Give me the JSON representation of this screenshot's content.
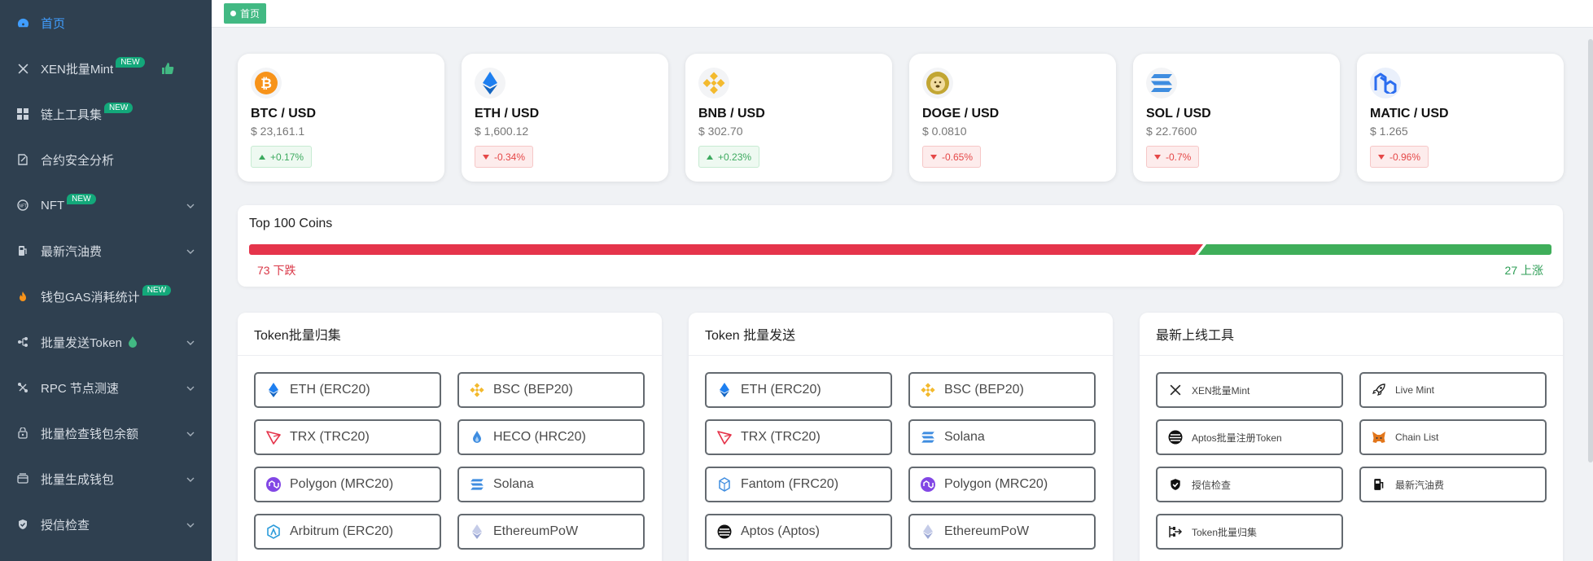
{
  "sidebar": {
    "items": [
      {
        "label": "首页",
        "icon": "dashboard-icon",
        "active": true
      },
      {
        "label": "XEN批量Mint",
        "icon": "x-icon",
        "badge": "NEW"
      },
      {
        "label": "链上工具集",
        "icon": "grid-icon",
        "badge": "NEW"
      },
      {
        "label": "合约安全分析",
        "icon": "contract-icon"
      },
      {
        "label": "NFT",
        "icon": "nft-icon",
        "badge": "NEW",
        "expandable": true
      },
      {
        "label": "最新汽油费",
        "icon": "gas-pump-icon",
        "expandable": true
      },
      {
        "label": "钱包GAS消耗统计",
        "icon": "fire-icon",
        "badge": "NEW"
      },
      {
        "label": "批量发送Token",
        "icon": "send-icon",
        "expandable": true
      },
      {
        "label": "RPC 节点测速",
        "icon": "speed-icon",
        "expandable": true
      },
      {
        "label": "批量检查钱包余额",
        "icon": "balance-icon",
        "expandable": true
      },
      {
        "label": "批量生成钱包",
        "icon": "wallet-icon",
        "expandable": true
      },
      {
        "label": "授信检查",
        "icon": "shield-icon",
        "expandable": true
      }
    ]
  },
  "tagbar": {
    "home_tag": "首页"
  },
  "prices": [
    {
      "pair": "BTC / USD",
      "price": "$ 23,161.1",
      "change": "+0.17%",
      "direction": "up",
      "icon": "bitcoin-icon",
      "color": "#f7931a"
    },
    {
      "pair": "ETH / USD",
      "price": "$ 1,600.12",
      "change": "-0.34%",
      "direction": "down",
      "icon": "ethereum-icon",
      "color": "#1e7ff0"
    },
    {
      "pair": "BNB / USD",
      "price": "$ 302.70",
      "change": "+0.23%",
      "direction": "up",
      "icon": "bnb-icon",
      "color": "#f3ba2f"
    },
    {
      "pair": "DOGE / USD",
      "price": "$ 0.0810",
      "change": "-0.65%",
      "direction": "down",
      "icon": "doge-icon",
      "color": "#c2a633"
    },
    {
      "pair": "SOL / USD",
      "price": "$ 22.7600",
      "change": "-0.7%",
      "direction": "down",
      "icon": "solana-icon",
      "color": "#3f8de0"
    },
    {
      "pair": "MATIC / USD",
      "price": "$ 1.265",
      "change": "-0.96%",
      "direction": "down",
      "icon": "matic-icon",
      "color": "#2b6def"
    }
  ],
  "top100": {
    "title": "Top 100 Coins",
    "down_count": 73,
    "up_count": 27,
    "down_label": "73 下跌",
    "up_label": "27 上涨"
  },
  "panels": [
    {
      "title": "Token批量归集",
      "buttons": [
        {
          "label": "ETH (ERC20)",
          "icon": "ethereum-icon"
        },
        {
          "label": "BSC (BEP20)",
          "icon": "bnb-icon"
        },
        {
          "label": "TRX (TRC20)",
          "icon": "tron-icon"
        },
        {
          "label": "HECO (HRC20)",
          "icon": "heco-icon"
        },
        {
          "label": "Polygon (MRC20)",
          "icon": "polygon-icon"
        },
        {
          "label": "Solana",
          "icon": "solana-icon"
        },
        {
          "label": "Arbitrum (ERC20)",
          "icon": "arbitrum-icon"
        },
        {
          "label": "EthereumPoW",
          "icon": "ethpow-icon"
        }
      ]
    },
    {
      "title": "Token 批量发送",
      "buttons": [
        {
          "label": "ETH (ERC20)",
          "icon": "ethereum-icon"
        },
        {
          "label": "BSC (BEP20)",
          "icon": "bnb-icon"
        },
        {
          "label": "TRX (TRC20)",
          "icon": "tron-icon"
        },
        {
          "label": "Solana",
          "icon": "solana-icon"
        },
        {
          "label": "Fantom (FRC20)",
          "icon": "fantom-icon"
        },
        {
          "label": "Polygon (MRC20)",
          "icon": "polygon-icon"
        },
        {
          "label": "Aptos (Aptos)",
          "icon": "aptos-icon"
        },
        {
          "label": "EthereumPoW",
          "icon": "ethpow-icon"
        }
      ]
    },
    {
      "title": "最新上线工具",
      "buttons": [
        {
          "label": "XEN批量Mint",
          "icon": "x-icon"
        },
        {
          "label": "Live Mint",
          "icon": "rocket-icon"
        },
        {
          "label": "Aptos批量注册Token",
          "icon": "aptos-icon"
        },
        {
          "label": "Chain List",
          "icon": "metamask-icon"
        },
        {
          "label": "授信检查",
          "icon": "shield-icon"
        },
        {
          "label": "最新汽油费",
          "icon": "gas-pump-icon"
        },
        {
          "label": "Token批量归集",
          "icon": "collect-icon"
        }
      ]
    }
  ],
  "colors": {
    "sidebar_bg": "#2f4050",
    "accent": "#409eff",
    "new_badge": "#13a87a",
    "up": "#3fae5a",
    "down": "#e5344b"
  }
}
